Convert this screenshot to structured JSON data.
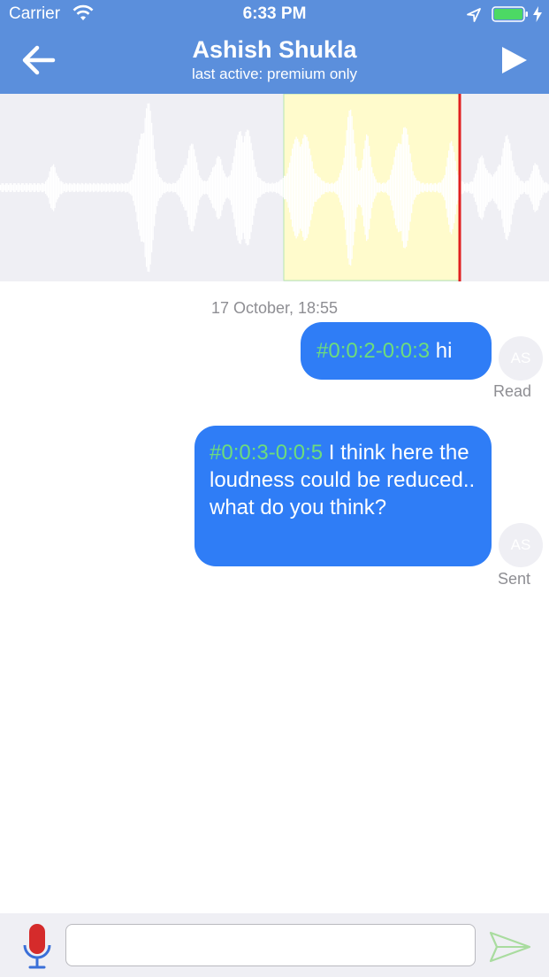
{
  "status_bar": {
    "carrier": "Carrier",
    "time": "6:33 PM"
  },
  "header": {
    "title": "Ashish Shukla",
    "subtitle": "last active: premium only",
    "back_icon": "back-arrow-icon",
    "play_icon": "play-icon"
  },
  "waveform": {
    "selection_color": "#fffbcc",
    "playhead_color": "#e02020"
  },
  "conversation": {
    "date": "17 October, 18:55",
    "messages": [
      {
        "timestamp_tag": "#0:0:2-0:0:3",
        "text": " hi",
        "avatar": "AS",
        "status": "Read"
      },
      {
        "timestamp_tag": "#0:0:3-0:0:5",
        "text": " I think here the loudness could be reduced.. what do you think?",
        "avatar": "AS",
        "status": "Sent"
      }
    ]
  },
  "composer": {
    "input_value": "",
    "mic_icon": "microphone-icon",
    "send_icon": "send-icon"
  },
  "colors": {
    "header_bg": "#5b8fdc",
    "bubble_bg": "#2f7df6",
    "timestamp_tag": "#6ddc7c",
    "muted_text": "#8e8e93",
    "mic_red": "#d52b2b",
    "mic_blue": "#3a6fd8"
  }
}
